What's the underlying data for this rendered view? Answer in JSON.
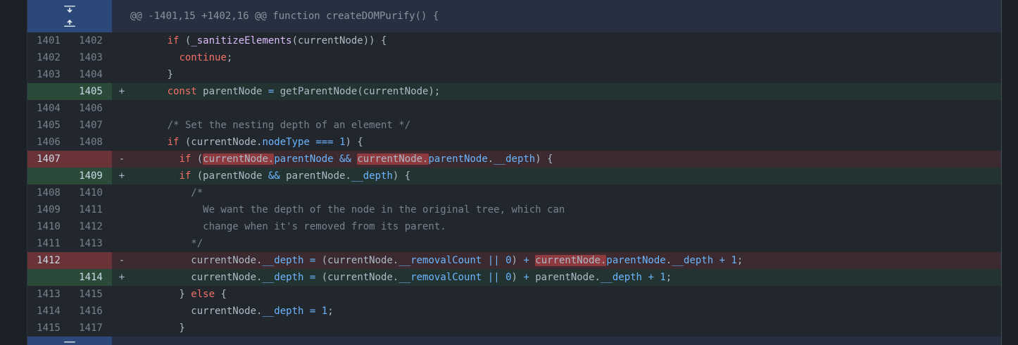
{
  "hunk": {
    "header": "@@ -1401,15 +1402,16 @@ function createDOMPurify() {",
    "expand_down_icon": "unfold-down-icon",
    "expand_up_icon": "unfold-up-icon"
  },
  "colors": {
    "added_row": "#233332",
    "deleted_row": "#3b2a30",
    "keyword": "#f47067",
    "property": "#6cb6ff"
  },
  "lines": [
    {
      "old": "1401",
      "new": "1402",
      "marker": "",
      "code": "      if (_sanitizeElements(currentNode)) {"
    },
    {
      "old": "1402",
      "new": "1403",
      "marker": "",
      "code": "        continue;"
    },
    {
      "old": "1403",
      "new": "1404",
      "marker": "",
      "code": "      }"
    },
    {
      "old": "",
      "new": "1405",
      "marker": "+",
      "code": "      const parentNode = getParentNode(currentNode);"
    },
    {
      "old": "1404",
      "new": "1406",
      "marker": "",
      "code": ""
    },
    {
      "old": "1405",
      "new": "1407",
      "marker": "",
      "code": "      /* Set the nesting depth of an element */"
    },
    {
      "old": "1406",
      "new": "1408",
      "marker": "",
      "code": "      if (currentNode.nodeType === 1) {"
    },
    {
      "old": "1407",
      "new": "",
      "marker": "-",
      "code": "        if (currentNode.parentNode && currentNode.parentNode.__depth) {"
    },
    {
      "old": "",
      "new": "1409",
      "marker": "+",
      "code": "        if (parentNode && parentNode.__depth) {"
    },
    {
      "old": "1408",
      "new": "1410",
      "marker": "",
      "code": "          /*"
    },
    {
      "old": "1409",
      "new": "1411",
      "marker": "",
      "code": "            We want the depth of the node in the original tree, which can"
    },
    {
      "old": "1410",
      "new": "1412",
      "marker": "",
      "code": "            change when it's removed from its parent."
    },
    {
      "old": "1411",
      "new": "1413",
      "marker": "",
      "code": "          */"
    },
    {
      "old": "1412",
      "new": "",
      "marker": "-",
      "code": "          currentNode.__depth = (currentNode.__removalCount || 0) + currentNode.parentNode.__depth + 1;"
    },
    {
      "old": "",
      "new": "1414",
      "marker": "+",
      "code": "          currentNode.__depth = (currentNode.__removalCount || 0) + parentNode.__depth + 1;"
    },
    {
      "old": "1413",
      "new": "1415",
      "marker": "",
      "code": "        } else {"
    },
    {
      "old": "1414",
      "new": "1416",
      "marker": "",
      "code": "          currentNode.__depth = 1;"
    },
    {
      "old": "1415",
      "new": "1417",
      "marker": "",
      "code": "        }"
    }
  ]
}
